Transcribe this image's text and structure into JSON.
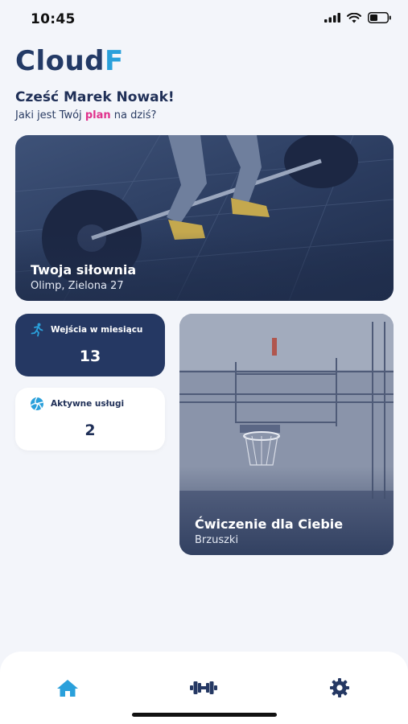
{
  "status_bar": {
    "time": "10:45"
  },
  "app": {
    "logo_main": "Cloud",
    "logo_accent": "F",
    "accent_color": "#2aa0db",
    "primary_color": "#253863",
    "highlight_color": "#e0318c"
  },
  "greeting": {
    "prefix": "Cześć ",
    "name": "Marek Nowak!"
  },
  "subtitle": {
    "before": "Jaki jest Twój ",
    "highlight": "plan",
    "after": " na dziś?"
  },
  "gym_card": {
    "title": "Twoja siłownia",
    "address": "Olimp, Zielona 27"
  },
  "stats": [
    {
      "label": "Wejścia w miesiącu",
      "value": "13",
      "icon": "running-person-icon"
    },
    {
      "label": "Aktywne usługi",
      "value": "2",
      "icon": "volleyball-icon"
    }
  ],
  "exercise_card": {
    "title": "Ćwiczenie dla Ciebie",
    "subtitle": "Brzuszki"
  },
  "nav": {
    "items": [
      "home-icon",
      "dumbbell-icon",
      "gear-icon"
    ],
    "active": "home-icon"
  }
}
